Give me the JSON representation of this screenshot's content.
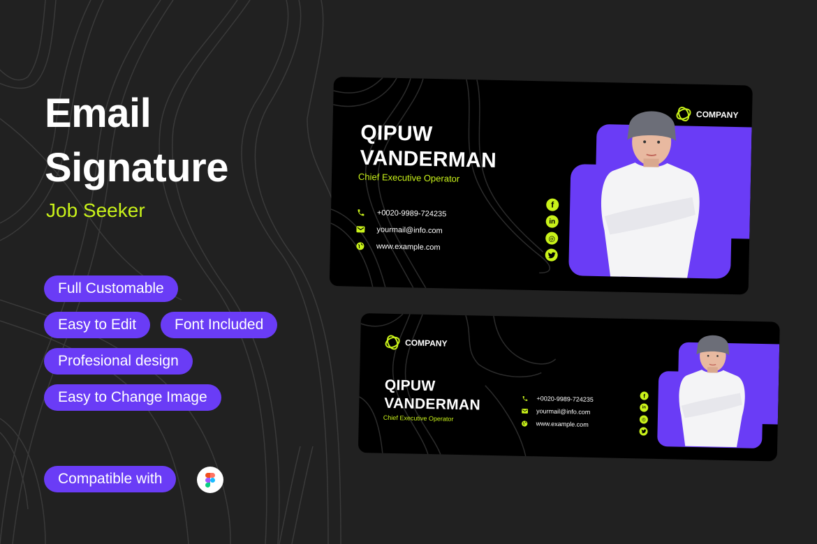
{
  "headline": {
    "line1": "Email",
    "line2": "Signature"
  },
  "subheadline": "Job Seeker",
  "features": [
    "Full Customable",
    "Easy to Edit",
    "Font Included",
    "Profesional design",
    "Easy to Change Image"
  ],
  "compatible": {
    "label": "Compatible with",
    "tool_icon": "figma-icon"
  },
  "colors": {
    "background": "#212121",
    "accent_purple": "#6a3cf6",
    "accent_lime": "#c9f21a",
    "card": "#000000"
  },
  "signature": {
    "company": "COMPANY",
    "first_name": "QIPUW",
    "last_name": "VANDERMAN",
    "role": "Chief Executive Operator",
    "contacts": [
      {
        "icon": "phone-icon",
        "text": "+0020-9989-724235"
      },
      {
        "icon": "mail-icon",
        "text": "yourmail@info.com"
      },
      {
        "icon": "globe-icon",
        "text": "www.example.com"
      }
    ],
    "socials": [
      {
        "icon": "facebook-icon",
        "glyph": "f"
      },
      {
        "icon": "linkedin-icon",
        "glyph": "in"
      },
      {
        "icon": "instagram-icon",
        "glyph": "◎"
      },
      {
        "icon": "twitter-icon",
        "glyph": "🐦"
      }
    ]
  }
}
